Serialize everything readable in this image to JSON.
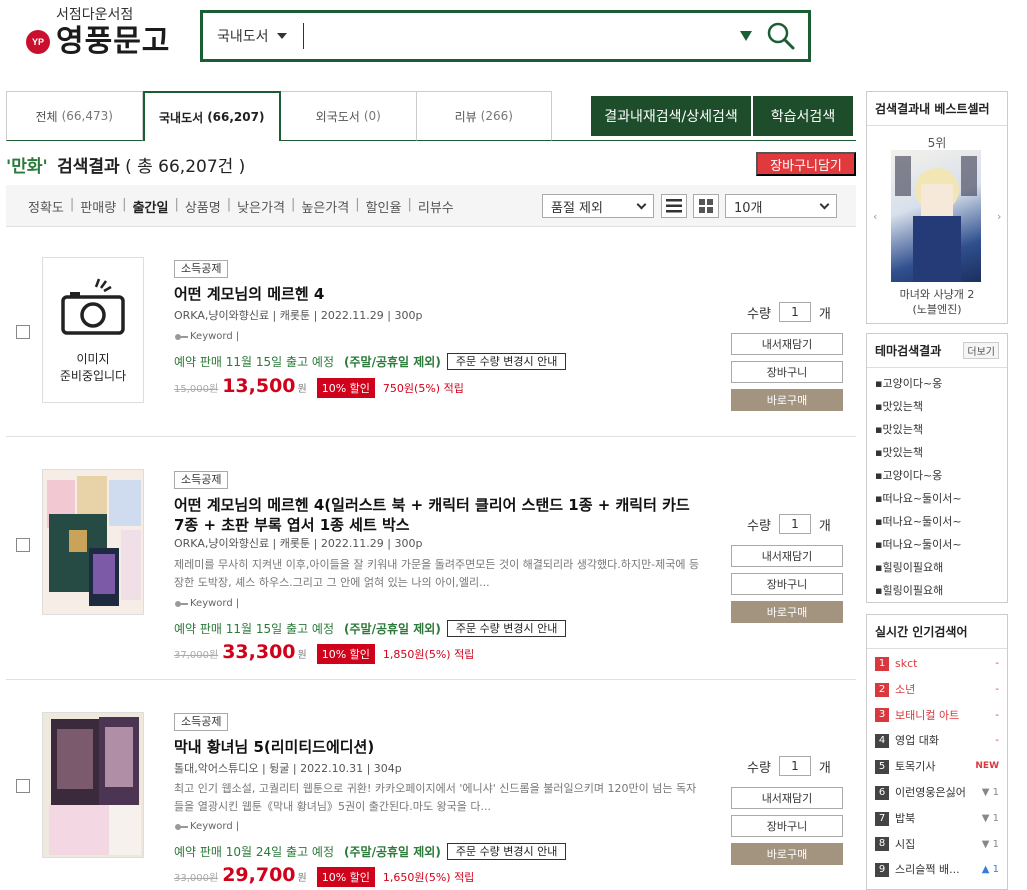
{
  "logo": {
    "tagline": "서점다운서점",
    "name": "영풍문고",
    "mark": "YP"
  },
  "search": {
    "category": "국내도서",
    "value": ""
  },
  "tabs": [
    {
      "label": "전체",
      "count": "(66,473)"
    },
    {
      "label": "국내도서",
      "count": "(66,207)"
    },
    {
      "label": "외국도서",
      "count": "(0)"
    },
    {
      "label": "리뷰",
      "count": "(266)"
    }
  ],
  "buttons": {
    "detail_search": "결과내재검색/상세검색",
    "study_search": "학습서검색",
    "add_cart": "장바구니담기"
  },
  "result": {
    "keyword": "'만화'",
    "label": "검색결과",
    "total": "( 총 66,207건 )"
  },
  "sort": {
    "options": [
      "정확도",
      "판매량",
      "출간일",
      "상품명",
      "낮은가격",
      "높은가격",
      "할인율",
      "리뷰수"
    ],
    "filter": "품절 제외",
    "per_page": "10개"
  },
  "common": {
    "qty_label": "수량",
    "qty_unit": "개",
    "keyword": "Keyword |",
    "wish": "내서재담기",
    "cart": "장바구니",
    "buy": "바로구매",
    "excluded": "(주말/공휴일 제외)",
    "notice": "주문 수량 변경시 안내",
    "won": "원",
    "no_image": "이미지\n준비중입니다"
  },
  "items": [
    {
      "badge": "소득공제",
      "title": "어떤 계모님의 메르헨 4",
      "meta": "ORKA,냥이와향신료 | 캐롯툰 | 2022.11.29 | 300p",
      "desc": "",
      "ship": "예약 판매 11월 15일 출고 예정",
      "orig": "15,000원",
      "price": "13,500",
      "discount": "10% 할인",
      "points": "750원(5%) 적립",
      "qty": "1"
    },
    {
      "badge": "소득공제",
      "title": "어떤 계모님의 메르헨 4(일러스트 북 + 캐릭터 클리어 스탠드 1종 + 캐릭터 카드 7종 + 초판 부록 엽서 1종 세트 박스",
      "meta": "ORKA,냥이와향신료 | 캐롯툰 | 2022.11.29 | 300p",
      "desc": "제레미를 무사히 지켜낸 이후,아이들을 잘 키워내 가문을 돌려주면모든 것이 해결되리라 생각했다.하지만-제국에 등장한 도박장, 셰스 하우스.그리고 그 안에 얽혀 있는 나의 아이,엘리...",
      "ship": "예약 판매 11월 15일 출고 예정",
      "orig": "37,000원",
      "price": "33,300",
      "discount": "10% 할인",
      "points": "1,850원(5%) 적립",
      "qty": "1"
    },
    {
      "badge": "소득공제",
      "title": "막내 황녀님 5(리미티드에디션)",
      "meta": "톨대,악어스튜디오 | 뒹굴 | 2022.10.31 | 304p",
      "desc": "최고 인기 웹소설, 고퀄리티 웹툰으로 귀환! 카카오페이지에서 '에니샤' 신드롬을 불러일으키며 120만이 넘는 독자들을 열광시킨 웹툰《막내 황녀님》5권이 출간된다.마도 왕국을 다...",
      "ship": "예약 판매 10월 24일 출고 예정",
      "orig": "33,000원",
      "price": "29,700",
      "discount": "10% 할인",
      "points": "1,650원(5%) 적립",
      "qty": "1"
    }
  ],
  "sidebar": {
    "best": {
      "title": "검색결과내 베스트셀러",
      "rank": "5위",
      "book": "마녀와 사냥개 2\n(노블엔진)"
    },
    "theme": {
      "title": "테마검색결과",
      "more": "더보기",
      "items": [
        "고양이다~옹",
        "맛있는책",
        "맛있는책",
        "맛있는책",
        "고양이다~옹",
        "떠나요~둘이서~",
        "떠나요~둘이서~",
        "떠나요~둘이서~",
        "힐링이필요해",
        "힐링이필요해"
      ]
    },
    "hot": {
      "title": "실시간 인기검색어",
      "items": [
        {
          "rank": "1",
          "term": "skct",
          "change": "-"
        },
        {
          "rank": "2",
          "term": "소년",
          "change": "-"
        },
        {
          "rank": "3",
          "term": "보태니컬 아트",
          "change": "-"
        },
        {
          "rank": "4",
          "term": "영업 대화",
          "change": "-"
        },
        {
          "rank": "5",
          "term": "토목기사",
          "change": "NEW"
        },
        {
          "rank": "6",
          "term": "이런영웅은싫어",
          "change": "▼ 1"
        },
        {
          "rank": "7",
          "term": "밥북",
          "change": "▼ 1"
        },
        {
          "rank": "8",
          "term": "시집",
          "change": "▼ 1"
        },
        {
          "rank": "9",
          "term": "스리슬쩍 배...",
          "change": "▲ 1"
        }
      ]
    }
  },
  "colors": {
    "brand_green": "#1e4d2b",
    "accent_red": "#d0021b",
    "buy_button": "#a39480"
  }
}
